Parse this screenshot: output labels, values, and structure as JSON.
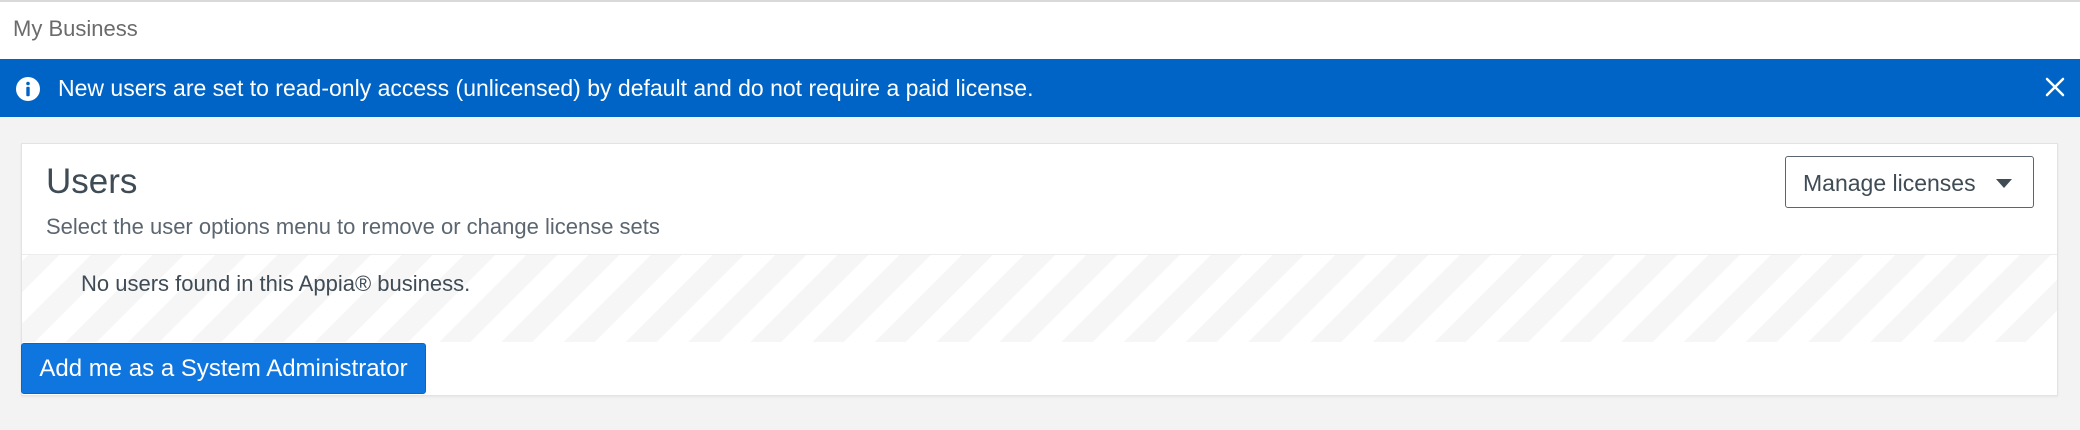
{
  "header": {
    "title": "My Business"
  },
  "banner": {
    "icon": "info-icon",
    "message": "New users are set to read-only access (unlicensed) by default and do not require a paid license.",
    "close_icon": "close-icon",
    "background_color": "#0064c6"
  },
  "users_panel": {
    "title": "Users",
    "subtitle": "Select the user options menu to remove or change license sets",
    "manage_licenses": {
      "label": "Manage licenses",
      "icon": "caret-down-icon"
    },
    "empty_message": "No users found in this Appia® business.",
    "add_admin_button": {
      "label": "Add me as a System Administrator",
      "color": "#1076df"
    }
  }
}
